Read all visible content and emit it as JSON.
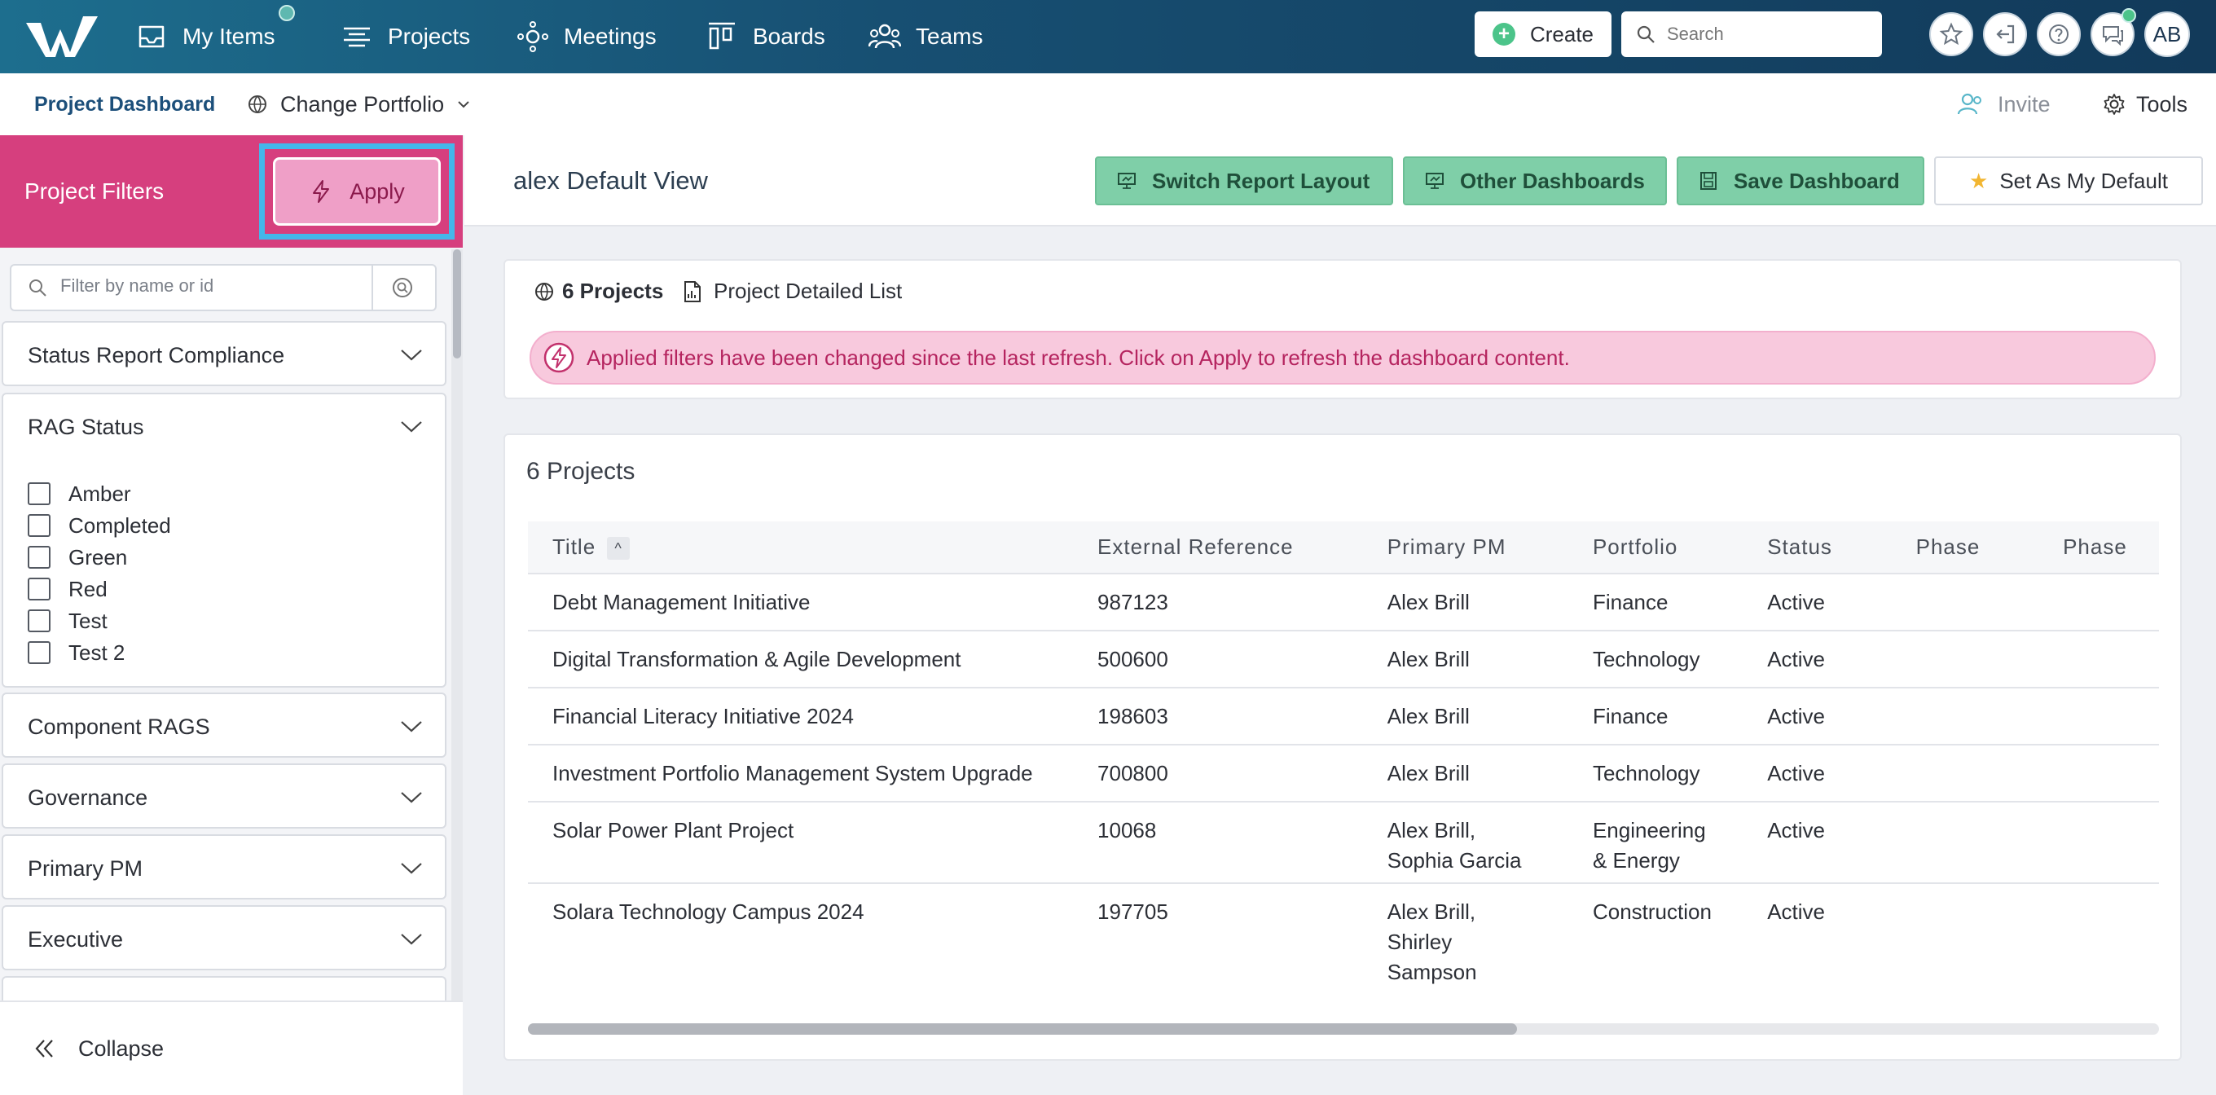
{
  "nav": {
    "items": [
      {
        "label": "My Items",
        "icon": "inbox-icon"
      },
      {
        "label": "Projects",
        "icon": "projects-icon"
      },
      {
        "label": "Meetings",
        "icon": "meetings-icon"
      },
      {
        "label": "Boards",
        "icon": "boards-icon"
      },
      {
        "label": "Teams",
        "icon": "teams-icon"
      }
    ],
    "create_label": "Create",
    "search_placeholder": "Search",
    "avatar_initials": "AB"
  },
  "subheader": {
    "title": "Project Dashboard",
    "portfolio_label": "Change Portfolio",
    "invite_label": "Invite",
    "tools_label": "Tools"
  },
  "sidebar": {
    "title": "Project Filters",
    "apply_label": "Apply",
    "filter_placeholder": "Filter by name or id",
    "sections": [
      {
        "label": "Status Report Compliance"
      },
      {
        "label": "RAG Status",
        "options": [
          "Amber",
          "Completed",
          "Green",
          "Red",
          "Test",
          "Test 2"
        ]
      },
      {
        "label": "Component RAGS"
      },
      {
        "label": "Governance"
      },
      {
        "label": "Primary PM"
      },
      {
        "label": "Executive"
      }
    ],
    "collapse_label": "Collapse"
  },
  "main": {
    "view_title": "alex Default View",
    "buttons": {
      "switch_layout": "Switch Report Layout",
      "other_dashboards": "Other Dashboards",
      "save_dashboard": "Save Dashboard",
      "set_default": "Set As My Default"
    },
    "summary": {
      "count_label": "6 Projects",
      "list_label": "Project Detailed List",
      "alert": "Applied filters have been changed since the last refresh. Click on Apply to refresh the dashboard content."
    },
    "table_card": {
      "title": "6 Projects",
      "columns": [
        "Title",
        "External Reference",
        "Primary PM",
        "Portfolio",
        "Status",
        "Phase",
        "Phase"
      ],
      "rows": [
        {
          "title": "Debt Management Initiative",
          "ref": "987123",
          "pm": [
            "Alex Brill"
          ],
          "portfolio": [
            "Finance"
          ],
          "status": "Active"
        },
        {
          "title": "Digital Transformation & Agile Development",
          "ref": "500600",
          "pm": [
            "Alex Brill"
          ],
          "portfolio": [
            "Technology"
          ],
          "status": "Active"
        },
        {
          "title": "Financial Literacy Initiative 2024",
          "ref": "198603",
          "pm": [
            "Alex Brill"
          ],
          "portfolio": [
            "Finance"
          ],
          "status": "Active"
        },
        {
          "title": "Investment Portfolio Management System Upgrade",
          "ref": "700800",
          "pm": [
            "Alex Brill"
          ],
          "portfolio": [
            "Technology"
          ],
          "status": "Active"
        },
        {
          "title": "Solar Power Plant Project",
          "ref": "10068",
          "pm": [
            "Alex Brill,",
            "Sophia Garcia"
          ],
          "portfolio": [
            "Engineering",
            "& Energy"
          ],
          "status": "Active"
        },
        {
          "title": "Solara Technology Campus 2024",
          "ref": "197705",
          "pm": [
            "Alex Brill,",
            "Shirley",
            "Sampson"
          ],
          "portfolio": [
            "Construction"
          ],
          "status": "Active"
        }
      ]
    }
  },
  "colors": {
    "nav_bg": "#174f72",
    "filter_head": "#d63f7e",
    "apply_btn": "#ef9fc7",
    "apply_highlight": "#44b6ea",
    "green_btn": "#7fcfa8",
    "alert_bg": "#f8c9dd"
  }
}
